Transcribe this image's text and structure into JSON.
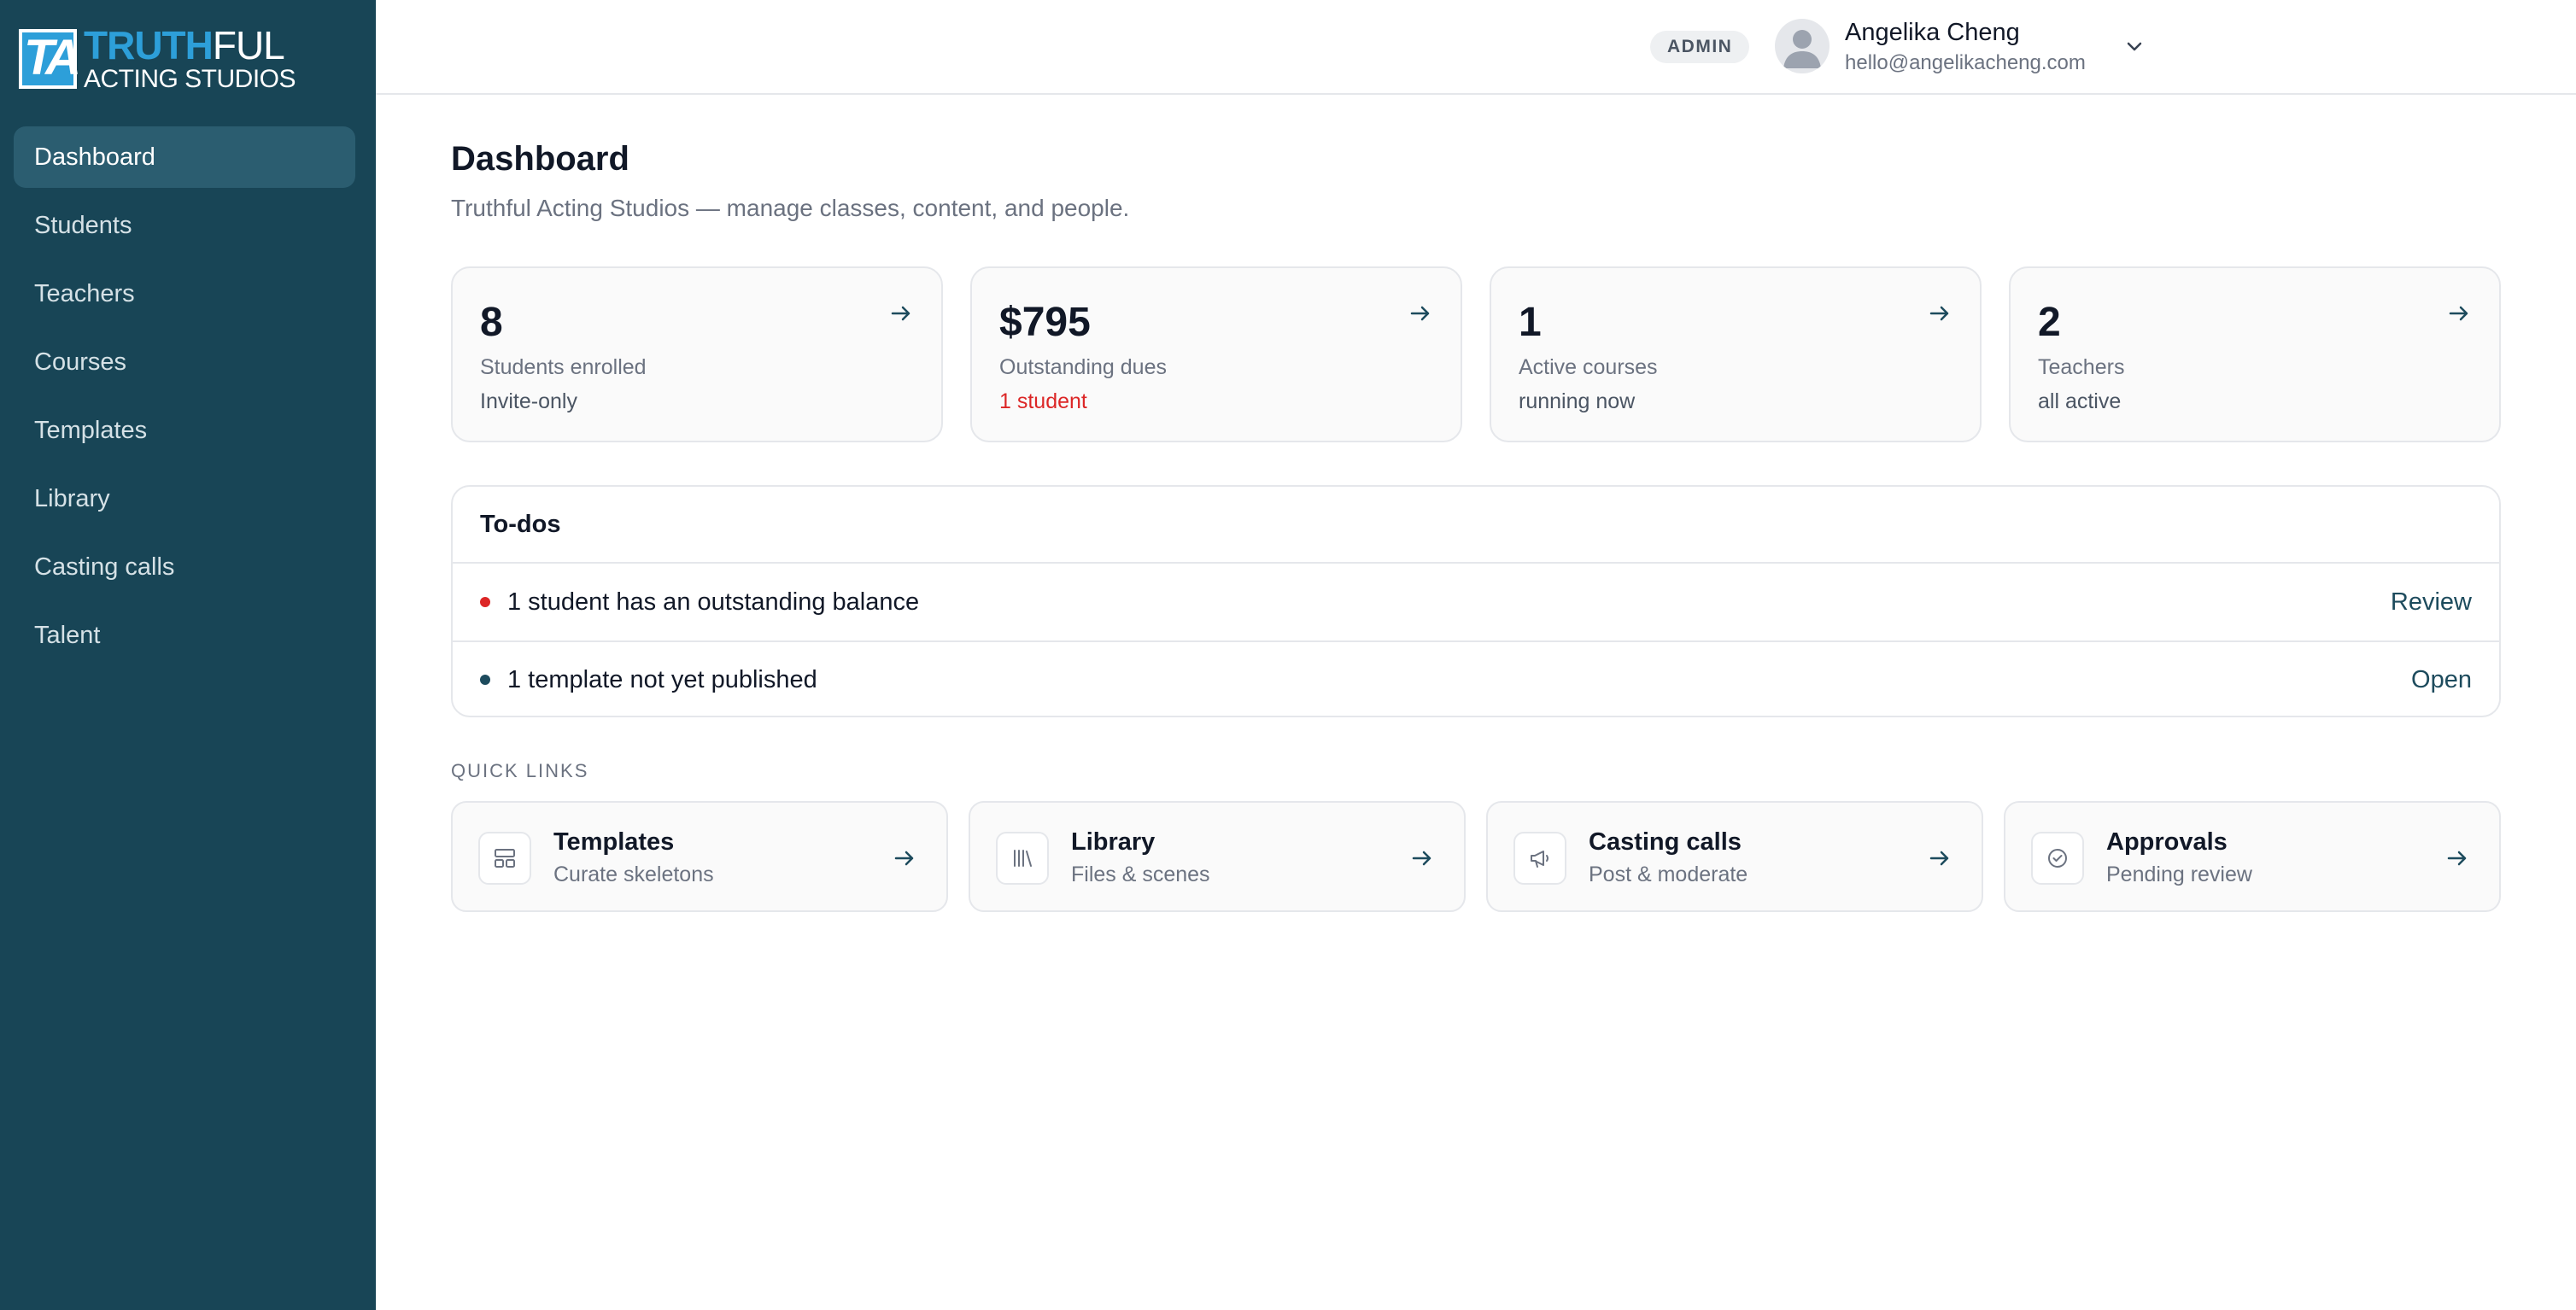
{
  "brand": {
    "mark": "TA",
    "line1_highlight": "TRUTH",
    "line1_rest": "FUL",
    "line2": "ACTING STUDIOS"
  },
  "sidebar": {
    "items": [
      {
        "label": "Dashboard",
        "active": true
      },
      {
        "label": "Students"
      },
      {
        "label": "Teachers"
      },
      {
        "label": "Courses"
      },
      {
        "label": "Templates"
      },
      {
        "label": "Library"
      },
      {
        "label": "Casting calls"
      },
      {
        "label": "Talent"
      }
    ]
  },
  "header": {
    "role_badge": "ADMIN",
    "user_name": "Angelika Cheng",
    "user_email": "hello@angelikacheng.com"
  },
  "main": {
    "title": "Dashboard",
    "subtitle": "Truthful Acting Studios — manage classes, content, and people.",
    "stats": [
      {
        "value": "8",
        "label": "Students enrolled",
        "sub": "Invite-only"
      },
      {
        "value": "$795",
        "label": "Outstanding dues",
        "sub": "1 student"
      },
      {
        "value": "1",
        "label": "Active courses",
        "sub": "running now"
      },
      {
        "value": "2",
        "label": "Teachers",
        "sub": "all active"
      }
    ],
    "todos": {
      "title": "To-dos",
      "items": [
        {
          "text": "1 student has an outstanding balance",
          "action": "Review"
        },
        {
          "text": "1 template not yet published",
          "action": "Open"
        }
      ]
    },
    "quick_links_label": "QUICK LINKS",
    "quick_links": [
      {
        "title": "Templates",
        "sub": "Curate skeletons",
        "icon": "layout-icon"
      },
      {
        "title": "Library",
        "sub": "Files & scenes",
        "icon": "library-icon"
      },
      {
        "title": "Casting calls",
        "sub": "Post & moderate",
        "icon": "megaphone-icon"
      },
      {
        "title": "Approvals",
        "sub": "Pending review",
        "icon": "check-circle-icon"
      }
    ]
  },
  "colors": {
    "sidebar_bg": "#184556",
    "sidebar_active": "#2b5d70",
    "brand_accent": "#2d9fd9",
    "alert": "#dc2626",
    "link": "#1d4b5d"
  }
}
